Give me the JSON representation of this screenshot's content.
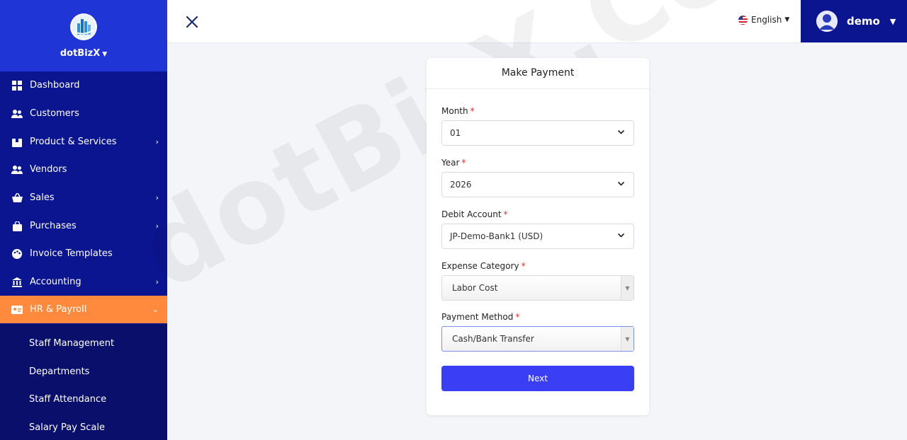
{
  "brand": {
    "name": "dotBizX"
  },
  "sidebar": {
    "items": [
      {
        "label": "Dashboard",
        "icon": "dashboard-icon",
        "has_caret": false
      },
      {
        "label": "Customers",
        "icon": "users-icon",
        "has_caret": false
      },
      {
        "label": "Product & Services",
        "icon": "box-icon",
        "has_caret": true
      },
      {
        "label": "Vendors",
        "icon": "users-icon",
        "has_caret": false
      },
      {
        "label": "Sales",
        "icon": "basket-icon",
        "has_caret": true
      },
      {
        "label": "Purchases",
        "icon": "bag-icon",
        "has_caret": true
      },
      {
        "label": "Invoice Templates",
        "icon": "palette-icon",
        "has_caret": false
      },
      {
        "label": "Accounting",
        "icon": "bank-icon",
        "has_caret": true
      },
      {
        "label": "HR & Payroll",
        "icon": "id-card-icon",
        "has_caret": true,
        "active": true
      }
    ],
    "submenu": [
      "Staff Management",
      "Departments",
      "Staff Attendance",
      "Salary Pay Scale"
    ]
  },
  "header": {
    "language": "English",
    "user": "demo"
  },
  "watermark": "dotBizX.Com",
  "form": {
    "title": "Make Payment",
    "month": {
      "label": "Month",
      "value": "01"
    },
    "year": {
      "label": "Year",
      "value": "2026"
    },
    "debit_account": {
      "label": "Debit Account",
      "value": "JP-Demo-Bank1 (USD)"
    },
    "expense_category": {
      "label": "Expense Category",
      "value": "Labor Cost"
    },
    "payment_method": {
      "label": "Payment Method",
      "value": "Cash/Bank Transfer"
    },
    "required_mark": "*",
    "next_label": "Next"
  },
  "colors": {
    "sidebar_bg": "#0b1590",
    "brand_bg": "#1f35d6",
    "active_item": "#ff8a3d",
    "primary_button": "#3a3ff5",
    "required": "#e03131"
  }
}
